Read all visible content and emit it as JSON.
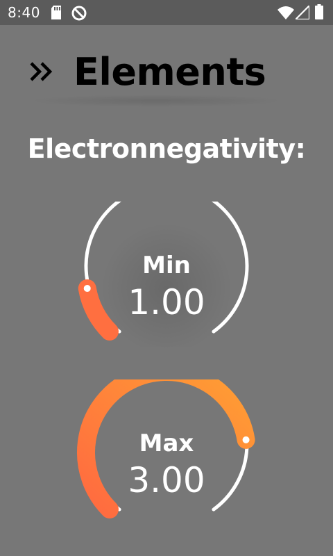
{
  "status_bar": {
    "time": "8:40",
    "icons": [
      "sd-card-icon",
      "no-sync-icon",
      "wifi-icon",
      "signal-icon",
      "battery-icon"
    ]
  },
  "header": {
    "icon": "double-chevron-right-icon",
    "title": "Elements"
  },
  "section": {
    "title": "Electronnegativity:"
  },
  "gauges": [
    {
      "label": "Min",
      "value": "1.00",
      "fraction": 0.13
    },
    {
      "label": "Max",
      "value": "3.00",
      "fraction": 0.8
    }
  ],
  "colors": {
    "background": "#777777",
    "statusbar": "#5b5b5b",
    "track": "#ffffff",
    "accent_start": "#ff6f40",
    "accent_end": "#ffa033"
  }
}
